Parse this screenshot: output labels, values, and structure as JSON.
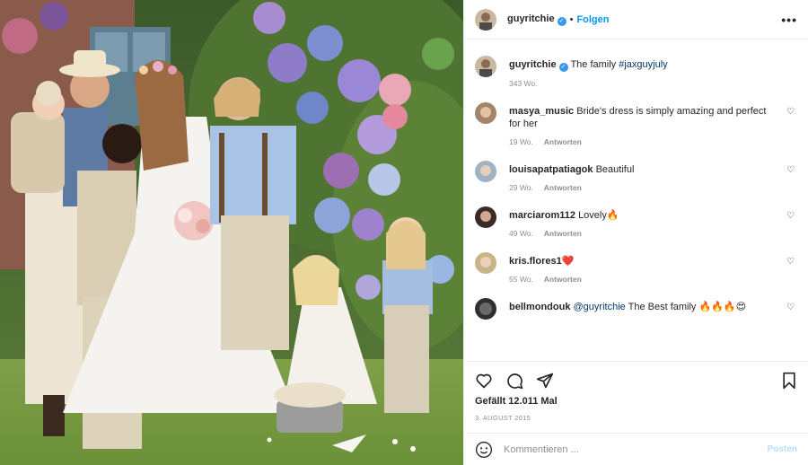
{
  "post": {
    "author": "guyritchie",
    "follow_label": "Folgen",
    "more_icon": "more-options-icon",
    "separator": "•"
  },
  "caption": {
    "username": "guyritchie",
    "text": "The family",
    "hashtag": "#jaxguyjuly",
    "age": "343 Wo."
  },
  "comments": [
    {
      "username": "masya_music",
      "text": "Bride's dress is simply amazing and perfect for her",
      "age": "19 Wo.",
      "reply": "Antworten"
    },
    {
      "username": "louisapatpatiagok",
      "text": "Beautiful",
      "age": "29 Wo.",
      "reply": "Antworten"
    },
    {
      "username": "marciarom112",
      "text": "Lovely🔥",
      "age": "49 Wo.",
      "reply": "Antworten"
    },
    {
      "username": "kris.flores1❤️",
      "text": "",
      "age": "55 Wo.",
      "reply": "Antworten"
    },
    {
      "username": "bellmondouk",
      "mention": "@guyritchie",
      "text": "The Best family 🔥🔥🔥😍",
      "age": "",
      "reply": ""
    }
  ],
  "engagement": {
    "likes": "Gefällt 12.011 Mal",
    "date": "3. AUGUST 2015"
  },
  "composer": {
    "placeholder": "Kommentieren ...",
    "post_label": "Posten"
  },
  "colors": {
    "accent": "#0095f6",
    "verified": "#3897f0",
    "muted": "#8e8e8e",
    "post_disabled": "#b2dffc"
  }
}
